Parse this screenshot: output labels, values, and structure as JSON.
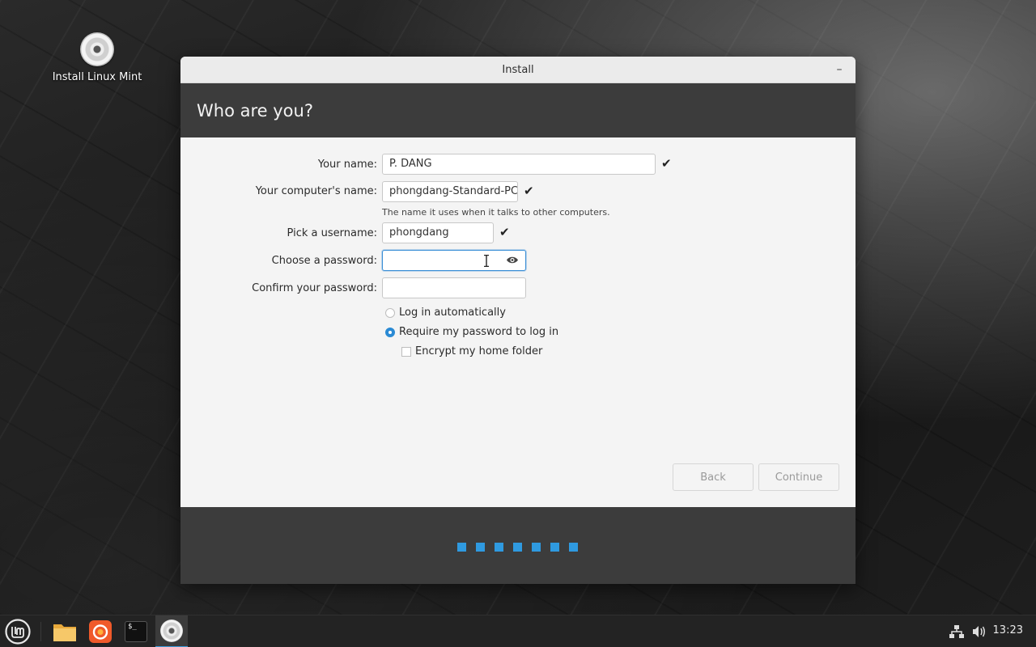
{
  "desktop": {
    "icon_label": "Install Linux Mint"
  },
  "window": {
    "title": "Install",
    "minimize_glyph": "–",
    "header_title": "Who are you?",
    "form": {
      "name_label": "Your name:",
      "name_value": "P. DANG",
      "computer_label": "Your computer's name:",
      "computer_value": "phongdang-Standard-PC",
      "computer_hint": "The name it uses when it talks to other computers.",
      "username_label": "Pick a username:",
      "username_value": "phongdang",
      "password_label": "Choose a password:",
      "password_value": "",
      "confirm_label": "Confirm your password:",
      "confirm_value": "",
      "check_glyph": "✔",
      "login_auto_label": "Log in automatically",
      "require_password_label": "Require my password to log in",
      "encrypt_label": "Encrypt my home folder",
      "selected_login_option": "require_password",
      "encrypt_checked": false
    },
    "buttons": {
      "back": "Back",
      "continue": "Continue"
    },
    "progress": {
      "steps_total": 7,
      "accent": "#2f9ae0"
    }
  },
  "taskbar": {
    "clock": "13:23",
    "icons": [
      "mint-menu-icon",
      "folder-icon",
      "firefox-icon",
      "terminal-icon",
      "installer-disc-icon",
      "network-icon",
      "volume-icon"
    ],
    "terminal_glyph": "$_"
  }
}
